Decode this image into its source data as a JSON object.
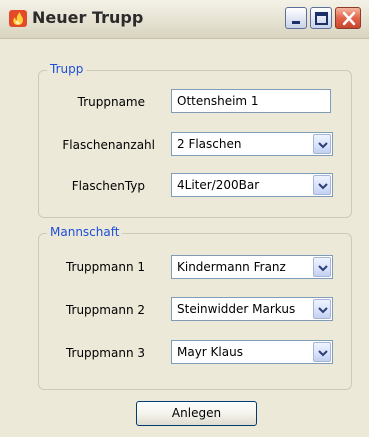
{
  "window": {
    "title": "Neuer Trupp",
    "icon": "flame-app-icon"
  },
  "trupp_group": {
    "legend": "Trupp",
    "truppname_label": "Truppname",
    "truppname_value": "Ottensheim 1",
    "flaschenanzahl_label": "Flaschenanzahl",
    "flaschenanzahl_value": "2 Flaschen",
    "flaschentyp_label": "FlaschenTyp",
    "flaschentyp_value": "4Liter/200Bar"
  },
  "mannschaft_group": {
    "legend": "Mannschaft",
    "members": [
      {
        "label": "Truppmann 1",
        "value": "Kindermann Franz"
      },
      {
        "label": "Truppmann 2",
        "value": "Steinwidder Markus"
      },
      {
        "label": "Truppmann 3",
        "value": "Mayr Klaus"
      }
    ]
  },
  "actions": {
    "create_label": "Anlegen"
  },
  "colors": {
    "legend_text": "#1d4fd8",
    "dialog_bg": "#ece9d8",
    "close_button": "#e2644a"
  }
}
